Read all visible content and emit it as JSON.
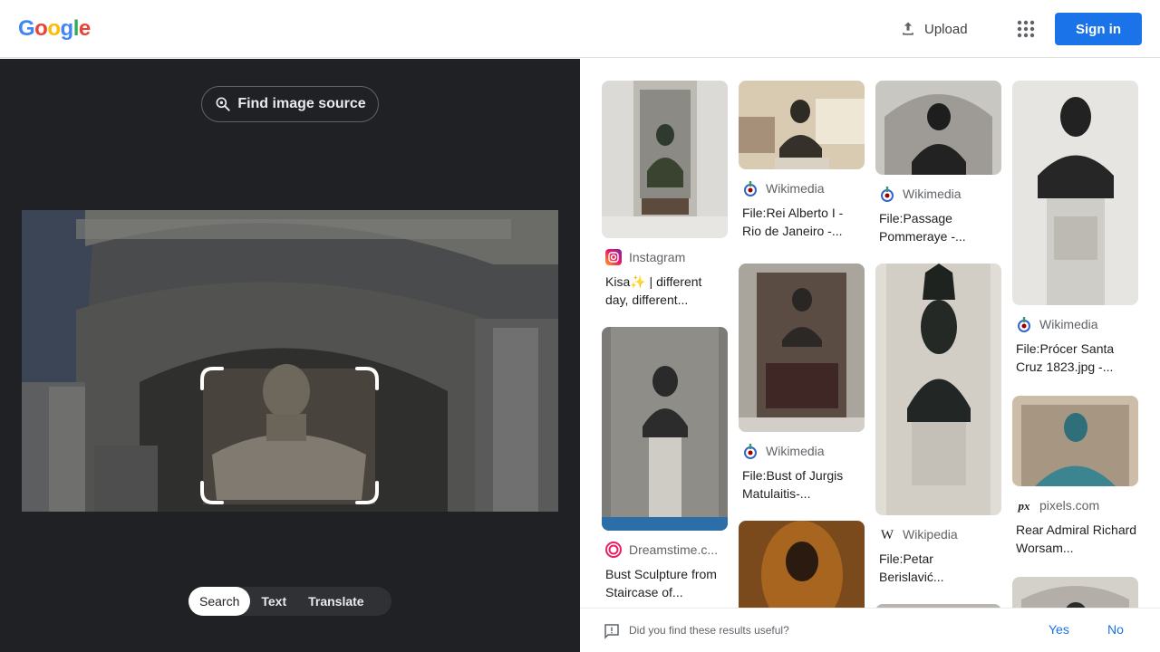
{
  "header": {
    "logo": [
      {
        "ch": "G",
        "color": "#4285f4"
      },
      {
        "ch": "o",
        "color": "#ea4335"
      },
      {
        "ch": "o",
        "color": "#fbbc05"
      },
      {
        "ch": "g",
        "color": "#4285f4"
      },
      {
        "ch": "l",
        "color": "#34a853"
      },
      {
        "ch": "e",
        "color": "#ea4335"
      }
    ],
    "upload_label": "Upload",
    "signin_label": "Sign in",
    "accent": "#1a73e8"
  },
  "lens": {
    "find_source_label": "Find image source",
    "modes": [
      {
        "label": "Search",
        "active": true
      },
      {
        "label": "Text",
        "active": false
      },
      {
        "label": "Translate",
        "active": false
      }
    ]
  },
  "results": [
    {
      "source": "Instagram",
      "favicon": "instagram-icon",
      "title": "Kisa✨ | different day, different..."
    },
    {
      "source": "Dreamstime.c...",
      "favicon": "dreamstime-icon",
      "title": "Bust Sculpture from Staircase of..."
    },
    {
      "source": "Wikimedia",
      "favicon": "wikimedia-icon",
      "title": "File:Rei Alberto I - Rio de Janeiro -..."
    },
    {
      "source": "Wikimedia",
      "favicon": "wikimedia-icon",
      "title": "File:Bust of Jurgis Matulaitis-..."
    },
    {
      "source": "Wikimedia",
      "favicon": "wikimedia-icon",
      "title": "File:Passage Pommeraye -..."
    },
    {
      "source": "Wikipedia",
      "favicon": "wikipedia-icon",
      "title": "File:Petar Berislavić..."
    },
    {
      "source": "Wikimedia",
      "favicon": "wikimedia-icon",
      "title": "File:Prócer Santa Cruz 1823.jpg -..."
    },
    {
      "source": "pixels.com",
      "favicon": "pixels-icon",
      "title": "Rear Admiral Richard Worsam..."
    }
  ],
  "feedback": {
    "question": "Did you find these results useful?",
    "yes": "Yes",
    "no": "No"
  }
}
